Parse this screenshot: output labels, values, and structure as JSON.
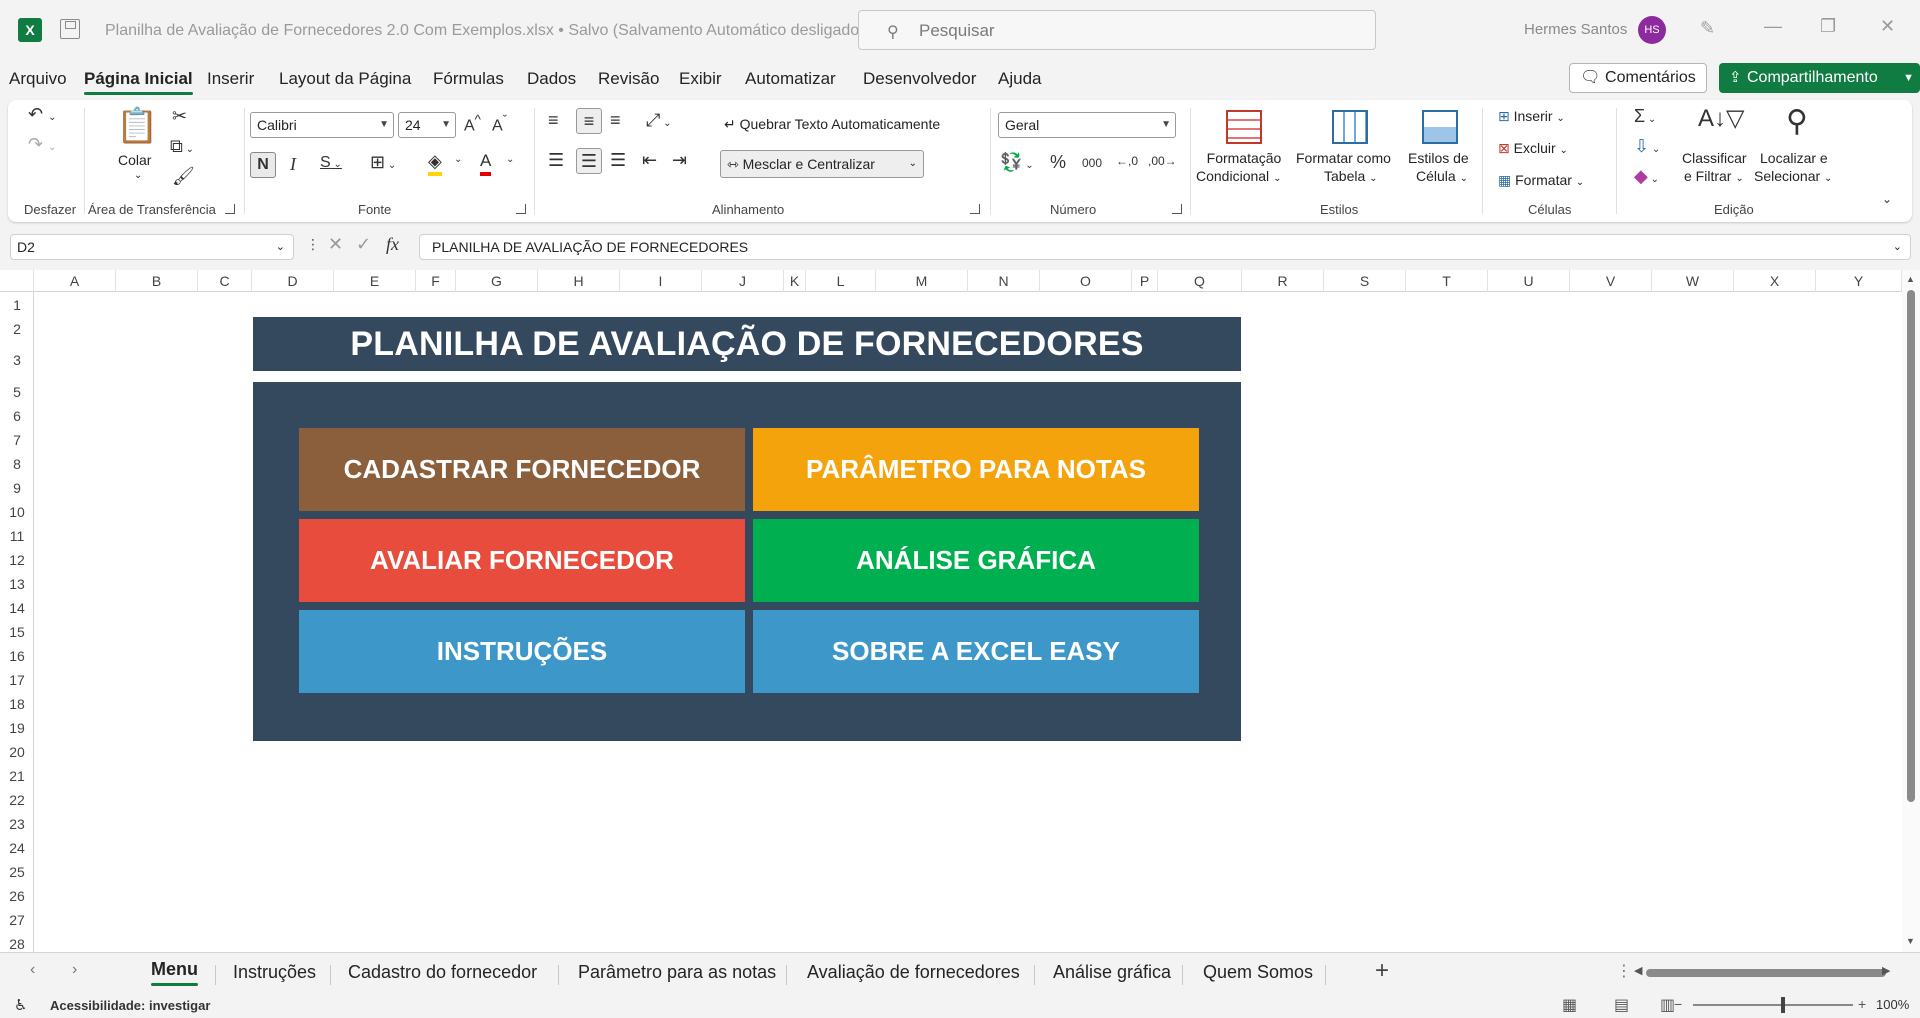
{
  "app": {
    "doc_title": "Planilha de Avaliação de Fornecedores 2.0 Com Exemplos.xlsx • Salvo (Salvamento Automático desligado)",
    "search_placeholder": "Pesquisar",
    "user_name": "Hermes Santos",
    "user_initials": "HS"
  },
  "menu": {
    "items": [
      "Arquivo",
      "Página Inicial",
      "Inserir",
      "Layout da Página",
      "Fórmulas",
      "Dados",
      "Revisão",
      "Exibir",
      "Automatizar",
      "Desenvolvedor",
      "Ajuda"
    ],
    "active": "Página Inicial",
    "comments_label": "Comentários",
    "share_label": "Compartilhamento"
  },
  "ribbon": {
    "undo_label": "Desfazer",
    "paste_label": "Colar",
    "clipboard_label": "Área de Transferência",
    "font_name": "Calibri",
    "font_size": "24",
    "font_label": "Fonte",
    "wrap_label": "Quebrar Texto Automaticamente",
    "merge_label": "Mesclar e Centralizar",
    "alignment_label": "Alinhamento",
    "number_format": "Geral",
    "number_label": "Número",
    "cond_format_label_1": "Formatação",
    "cond_format_label_2": "Condicional",
    "format_table_label_1": "Formatar como",
    "format_table_label_2": "Tabela",
    "cell_styles_label_1": "Estilos de",
    "cell_styles_label_2": "Célula",
    "styles_label": "Estilos",
    "insert_label": "Inserir",
    "delete_label": "Excluir",
    "format_label": "Formatar",
    "cells_label": "Células",
    "sort_label_1": "Classificar",
    "sort_label_2": "e Filtrar",
    "find_label_1": "Localizar e",
    "find_label_2": "Selecionar",
    "editing_label": "Edição"
  },
  "formula_bar": {
    "cell_ref": "D2",
    "content": "PLANILHA DE AVALIAÇÃO DE FORNECEDORES"
  },
  "columns": [
    "A",
    "B",
    "C",
    "D",
    "E",
    "F",
    "G",
    "H",
    "I",
    "J",
    "K",
    "L",
    "M",
    "N",
    "O",
    "P",
    "Q",
    "R",
    "S",
    "T",
    "U",
    "V",
    "W",
    "X",
    "Y"
  ],
  "rows": [
    "1",
    "2",
    "3",
    "5",
    "6",
    "7",
    "8",
    "9",
    "10",
    "11",
    "12",
    "13",
    "14",
    "15",
    "16",
    "17",
    "18",
    "19",
    "20",
    "21",
    "22",
    "23",
    "24",
    "25",
    "26",
    "27",
    "28"
  ],
  "dashboard": {
    "title": "PLANILHA DE AVALIAÇÃO DE FORNECEDORES",
    "buttons": [
      {
        "label": "CADASTRAR FORNECEDOR",
        "color": "#8b5e3c"
      },
      {
        "label": "PARÂMETRO PARA NOTAS",
        "color": "#f4a30d"
      },
      {
        "label": "AVALIAR FORNECEDOR",
        "color": "#e74c3c"
      },
      {
        "label": "ANÁLISE GRÁFICA",
        "color": "#00b050"
      },
      {
        "label": "INSTRUÇÕES",
        "color": "#3e97c9"
      },
      {
        "label": "SOBRE A EXCEL EASY",
        "color": "#3e97c9"
      }
    ],
    "panel_color": "#34495e"
  },
  "sheets": {
    "tabs": [
      "Menu",
      "Instruções",
      "Cadastro do fornecedor",
      "Parâmetro para as notas",
      "Avaliação de fornecedores",
      "Análise gráfica",
      "Quem Somos"
    ],
    "active": "Menu"
  },
  "status": {
    "accessibility": "Acessibilidade: investigar",
    "zoom": "100%"
  },
  "colors": {
    "accent": "#107c41",
    "avatar": "#8b2b9d"
  }
}
